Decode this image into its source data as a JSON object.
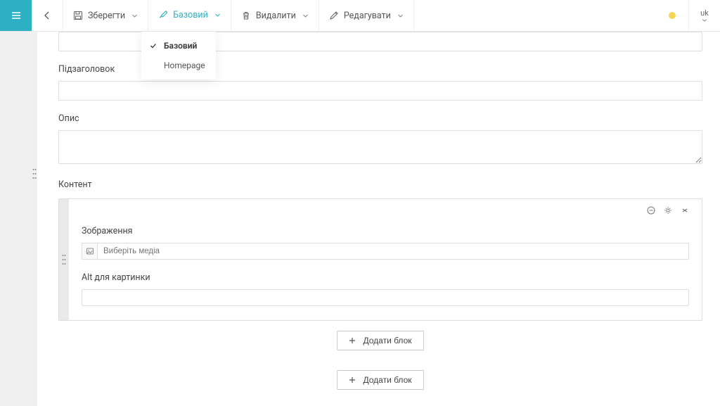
{
  "toolbar": {
    "save": "Зберегти",
    "basic": "Базовий",
    "delete": "Видалити",
    "edit": "Редагувати"
  },
  "locale": "uk",
  "dropdown": {
    "items": [
      "Базовий",
      "Homepage"
    ],
    "selected": 0
  },
  "fields": {
    "subtitle_label": "Підзаголовок",
    "description_label": "Опис",
    "content_label": "Контент",
    "image_label": "Зображення",
    "media_placeholder": "Виберіть медіа",
    "alt_label": "Alt для картинки"
  },
  "buttons": {
    "add_block": "Додати блок"
  }
}
